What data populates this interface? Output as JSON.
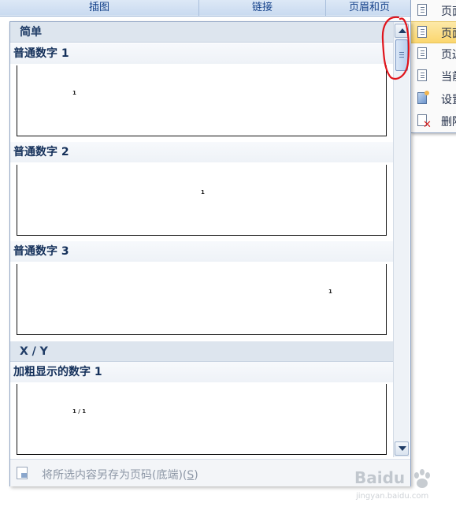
{
  "ribbon": {
    "groups": [
      "插图",
      "链接",
      "页眉和页"
    ]
  },
  "submenu": {
    "items": [
      {
        "label": "页面",
        "icon": "page-icon"
      },
      {
        "label": "页面",
        "icon": "page-icon",
        "active": true
      },
      {
        "label": "页边",
        "icon": "page-icon"
      },
      {
        "label": "当前",
        "icon": "page-icon"
      },
      {
        "label": "设置",
        "icon": "settings-icon"
      },
      {
        "label": "删除",
        "icon": "delete-icon"
      }
    ]
  },
  "gallery": {
    "sections": [
      {
        "title": "简单"
      },
      {
        "title": "X / Y"
      }
    ],
    "items": [
      {
        "title": "普通数字 1",
        "number": "1"
      },
      {
        "title": "普通数字 2",
        "number": "1"
      },
      {
        "title": "普通数字 3",
        "number": "1"
      },
      {
        "title": "加粗显示的数字 1",
        "number": "1 / 1"
      }
    ],
    "footer": {
      "label": "将所选内容另存为页码(底端)(",
      "shortcut": "S",
      "label_end": ")"
    }
  },
  "watermark": {
    "brand": "Baidu",
    "sub": "jingyan.baidu.com"
  }
}
